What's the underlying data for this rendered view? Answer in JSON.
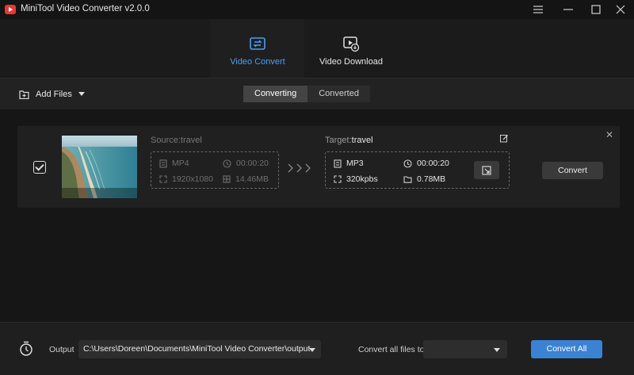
{
  "window": {
    "title": "MiniTool Video Converter v2.0.0",
    "buttons": [
      "menu-icon",
      "minimize-icon",
      "maximize-icon",
      "close-icon"
    ]
  },
  "nav": {
    "tabs": [
      {
        "label": "Video Convert",
        "icon": "convert-icon",
        "active": true
      },
      {
        "label": "Video Download",
        "icon": "download-icon",
        "active": false
      }
    ]
  },
  "toolbar": {
    "add_files": "Add Files",
    "segments": [
      {
        "label": "Converting",
        "active": true
      },
      {
        "label": "Converted",
        "active": false
      }
    ]
  },
  "item": {
    "source": {
      "label": "Source:",
      "name": "travel",
      "format": "MP4",
      "duration": "00:00:20",
      "resolution": "1920x1080",
      "size": "14.46MB"
    },
    "target": {
      "label": "Target:",
      "name": "travel",
      "format": "MP3",
      "duration": "00:00:20",
      "bitrate": "320kpbs",
      "size": "0.78MB"
    },
    "convert_label": "Convert"
  },
  "footer": {
    "output_label": "Output",
    "output_path": "C:\\Users\\Doreen\\Documents\\MiniTool Video Converter\\output",
    "convert_all_to_label": "Convert all files to",
    "convert_all_to_value": "",
    "convert_all_label": "Convert All"
  },
  "colors": {
    "accent": "#4a9ff5",
    "primary_button": "#3c82d4",
    "logo": "#e53935",
    "background": "#161616"
  }
}
